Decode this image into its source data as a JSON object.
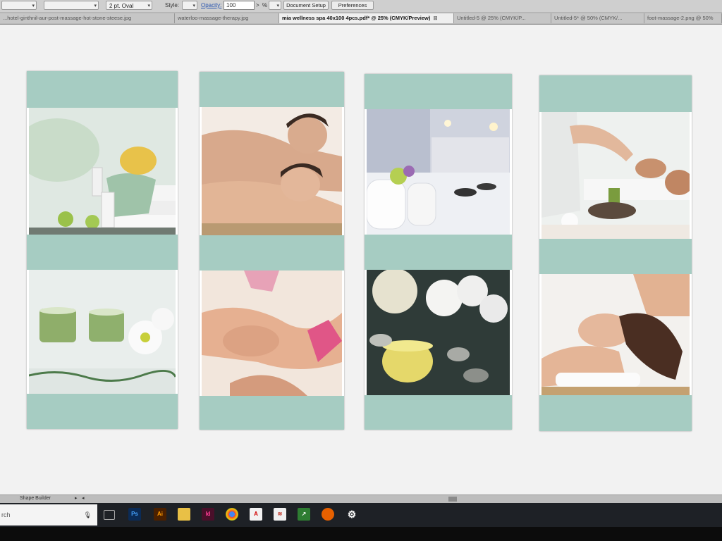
{
  "control_bar": {
    "stroke_size": "2 pt. Oval",
    "style_label": "Style:",
    "opacity_label": "Opacity:",
    "opacity_value": "100",
    "opacity_unit": "%",
    "document_setup_label": "Document Setup",
    "preferences_label": "Preferences"
  },
  "tabs": [
    {
      "label": "...hotel-ginthnil-aur-post-massage-hot-stone-steese.jpg",
      "active": false
    },
    {
      "label": "waterloo-massage-therapy.jpg",
      "active": false
    },
    {
      "label": "mia wellness spa 40x100 4pcs.pdf* @ 25% (CMYK/Preview)",
      "active": true
    },
    {
      "label": "Untitled-5 @ 25% (CMYK/P...",
      "active": false
    },
    {
      "label": "Untitled-5* @ 50% (CMYK/...",
      "active": false
    },
    {
      "label": "foot-massage-2.png @ 50%",
      "active": false
    }
  ],
  "panels_count_shown": 4,
  "colors": {
    "band": "#a6ccc2",
    "panel": "#ffffff",
    "canvas": "#f2f2f2",
    "taskbar": "#1e2126"
  },
  "status_bar": {
    "tool_label": "Shape Builder"
  },
  "taskbar": {
    "search_text": "rch",
    "apps": [
      {
        "name": "task-view-icon",
        "label": "▭"
      },
      {
        "name": "photoshop-icon",
        "label": "Ps"
      },
      {
        "name": "illustrator-icon",
        "label": "Ai"
      },
      {
        "name": "file-explorer-icon",
        "label": ""
      },
      {
        "name": "indesign-icon",
        "label": "Id"
      },
      {
        "name": "chrome-icon",
        "label": ""
      },
      {
        "name": "acrobat-icon",
        "label": ""
      },
      {
        "name": "app-red-icon",
        "label": ""
      },
      {
        "name": "app-green-icon",
        "label": ""
      },
      {
        "name": "firefox-icon",
        "label": ""
      },
      {
        "name": "settings-icon",
        "label": "⚙"
      }
    ]
  }
}
